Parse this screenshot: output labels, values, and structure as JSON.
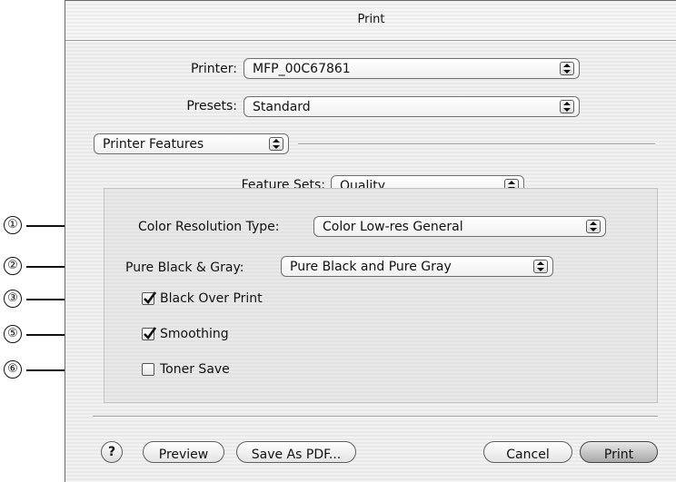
{
  "window": {
    "title": "Print"
  },
  "printer": {
    "label": "Printer:",
    "value": "MFP_00C67861"
  },
  "presets": {
    "label": "Presets:",
    "value": "Standard"
  },
  "panel_selector": {
    "value": "Printer Features"
  },
  "feature_sets": {
    "label": "Feature Sets:",
    "value": "Quality"
  },
  "color_resolution": {
    "label": "Color Resolution Type:",
    "value": "Color Low-res General"
  },
  "pure_black_gray": {
    "label": "Pure Black & Gray:",
    "value": "Pure Black and Pure Gray"
  },
  "checkboxes": [
    {
      "label": "Black Over Print",
      "checked": true
    },
    {
      "label": "Smoothing",
      "checked": true
    },
    {
      "label": "Toner Save",
      "checked": false
    }
  ],
  "callouts": [
    "①",
    "②",
    "③",
    "⑤",
    "⑥"
  ],
  "buttons": {
    "help": "?",
    "preview": "Preview",
    "save_pdf": "Save As PDF...",
    "cancel": "Cancel",
    "print": "Print"
  },
  "icons": {
    "popup_arrows": "updown-arrows-icon",
    "check": "checkmark-icon",
    "help": "help-icon"
  }
}
